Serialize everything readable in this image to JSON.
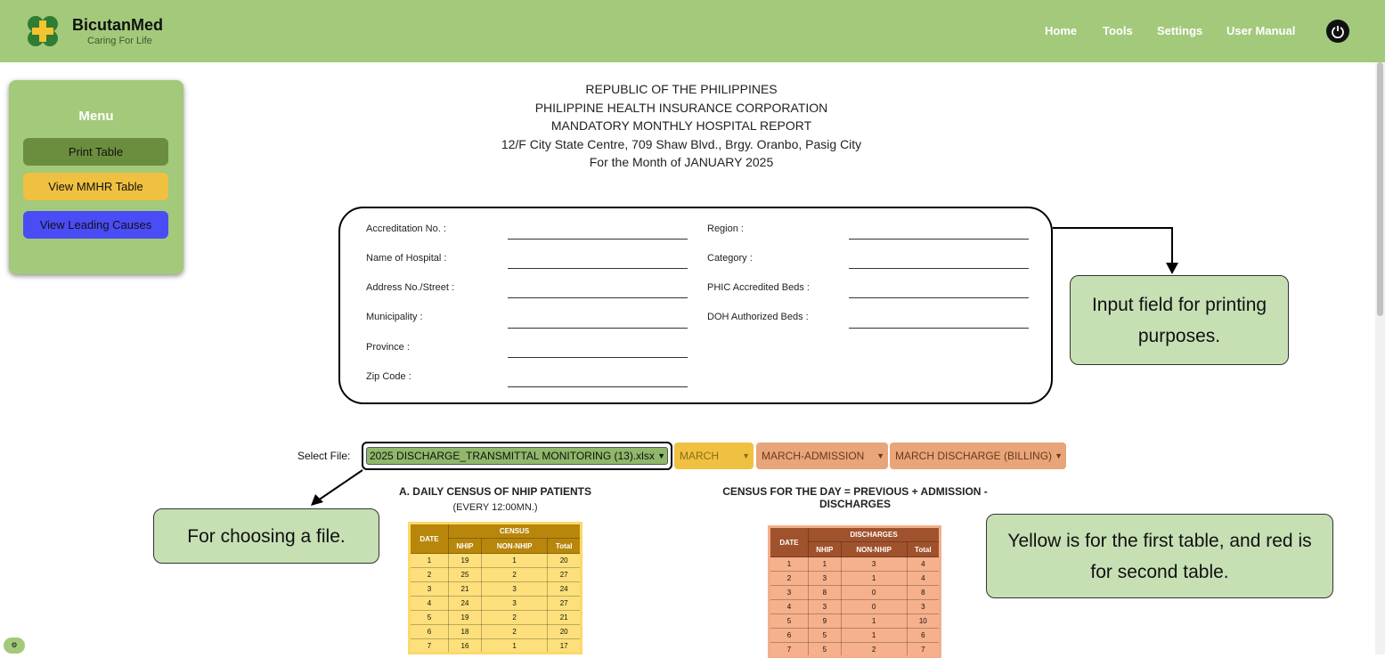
{
  "app": {
    "name": "BicutanMed",
    "tagline": "Caring For Life"
  },
  "nav": {
    "home": "Home",
    "tools": "Tools",
    "settings": "Settings",
    "manual": "User Manual"
  },
  "menu": {
    "title": "Menu",
    "print": "Print Table",
    "view_mmhr": "View MMHR Table",
    "view_causes": "View Leading Causes"
  },
  "report_header": [
    "REPUBLIC OF THE PHILIPPINES",
    "PHILIPPINE HEALTH INSURANCE CORPORATION",
    "MANDATORY MONTHLY HOSPITAL REPORT",
    "12/F City State Centre, 709 Shaw Blvd., Brgy. Oranbo, Pasig City",
    "For the Month of JANUARY 2025"
  ],
  "fields": {
    "accreditation": "Accreditation No. :",
    "hospital": "Name of Hospital :",
    "address": "Address No./Street :",
    "municipality": "Municipality :",
    "province": "Province :",
    "zip": "Zip Code :",
    "region": "Region :",
    "category": "Category :",
    "phic_beds": "PHIC Accredited Beds :",
    "doh_beds": "DOH Authorized Beds :"
  },
  "callouts": {
    "input": "Input field for printing purposes.",
    "file": "For choosing a file.",
    "colors": "Yellow is for the first table, and red is for second table."
  },
  "selector": {
    "label": "Select File:",
    "file": "2025 DISCHARGE_TRANSMITTAL MONITORING (13).xlsx",
    "month": "MARCH",
    "admission": "MARCH-ADMISSION",
    "discharge": "MARCH DISCHARGE (BILLING)"
  },
  "table_a": {
    "title": "A. DAILY CENSUS OF NHIP PATIENTS",
    "subtitle": "(EVERY 12:00MN.)",
    "date_header": "DATE",
    "group_header": "CENSUS",
    "cols": [
      "NHIP",
      "NON-NHIP",
      "Total"
    ],
    "rows": [
      [
        "1",
        "19",
        "1",
        "20"
      ],
      [
        "2",
        "25",
        "2",
        "27"
      ],
      [
        "3",
        "21",
        "3",
        "24"
      ],
      [
        "4",
        "24",
        "3",
        "27"
      ],
      [
        "5",
        "19",
        "2",
        "21"
      ],
      [
        "6",
        "18",
        "2",
        "20"
      ],
      [
        "7",
        "16",
        "1",
        "17"
      ]
    ]
  },
  "table_b": {
    "title": "CENSUS FOR THE DAY = PREVIOUS + ADMISSION - DISCHARGES",
    "date_header": "DATE",
    "group_header": "DISCHARGES",
    "cols": [
      "NHIP",
      "NON-NHIP",
      "Total"
    ],
    "rows": [
      [
        "1",
        "1",
        "3",
        "4"
      ],
      [
        "2",
        "3",
        "1",
        "4"
      ],
      [
        "3",
        "8",
        "0",
        "8"
      ],
      [
        "4",
        "3",
        "0",
        "3"
      ],
      [
        "5",
        "9",
        "1",
        "10"
      ],
      [
        "6",
        "5",
        "1",
        "6"
      ],
      [
        "7",
        "5",
        "2",
        "7"
      ]
    ]
  },
  "colors": {
    "topbar": "#a3c97b",
    "yellow": "#fde07b",
    "red": "#f6b08c",
    "callout": "#c6e0b4"
  }
}
